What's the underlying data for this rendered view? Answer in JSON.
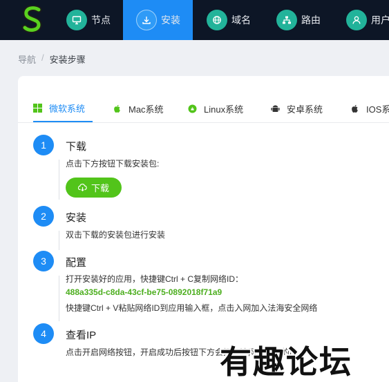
{
  "nav": {
    "items": [
      {
        "label": "节点",
        "icon": "monitor-icon"
      },
      {
        "label": "安装",
        "icon": "download-icon"
      },
      {
        "label": "域名",
        "icon": "globe-icon"
      },
      {
        "label": "路由",
        "icon": "network-icon"
      },
      {
        "label": "用户",
        "icon": "user-icon"
      }
    ],
    "active": "安装"
  },
  "breadcrumb": {
    "root": "导航",
    "separator": "/",
    "current": "安装步骤"
  },
  "tabs": [
    {
      "label": "微软系统",
      "icon": "windows-icon"
    },
    {
      "label": "Mac系统",
      "icon": "apple-icon"
    },
    {
      "label": "Linux系统",
      "icon": "linux-icon"
    },
    {
      "label": "安卓系统",
      "icon": "android-icon"
    },
    {
      "label": "IOS系",
      "icon": "apple-icon"
    }
  ],
  "steps": [
    {
      "num": "1",
      "title": "下载",
      "desc": "点击下方按钮下载安装包:",
      "button": "下载"
    },
    {
      "num": "2",
      "title": "安装",
      "desc": "双击下载的安装包进行安装"
    },
    {
      "num": "3",
      "title": "配置",
      "desc": "打开安装好的应用，快捷键Ctrl + C复制网络ID：",
      "network_id": "488a335d-c8da-43cf-be75-0892018f71a9",
      "desc2": "快捷键Ctrl + V粘贴网络ID到应用输入框，点击入网加入法海安全网络"
    },
    {
      "num": "4",
      "title": "查看IP",
      "desc": "点击开启网络按钮，开启成功后按钮下方会提示该网络分配的IP"
    }
  ],
  "watermark": "有趣论坛",
  "colors": {
    "topbar": "#0d1626",
    "accent": "#1e8cf5",
    "nav_icon": "#22b39a",
    "green_button": "#52c41a",
    "network_id": "#4cae1e"
  }
}
